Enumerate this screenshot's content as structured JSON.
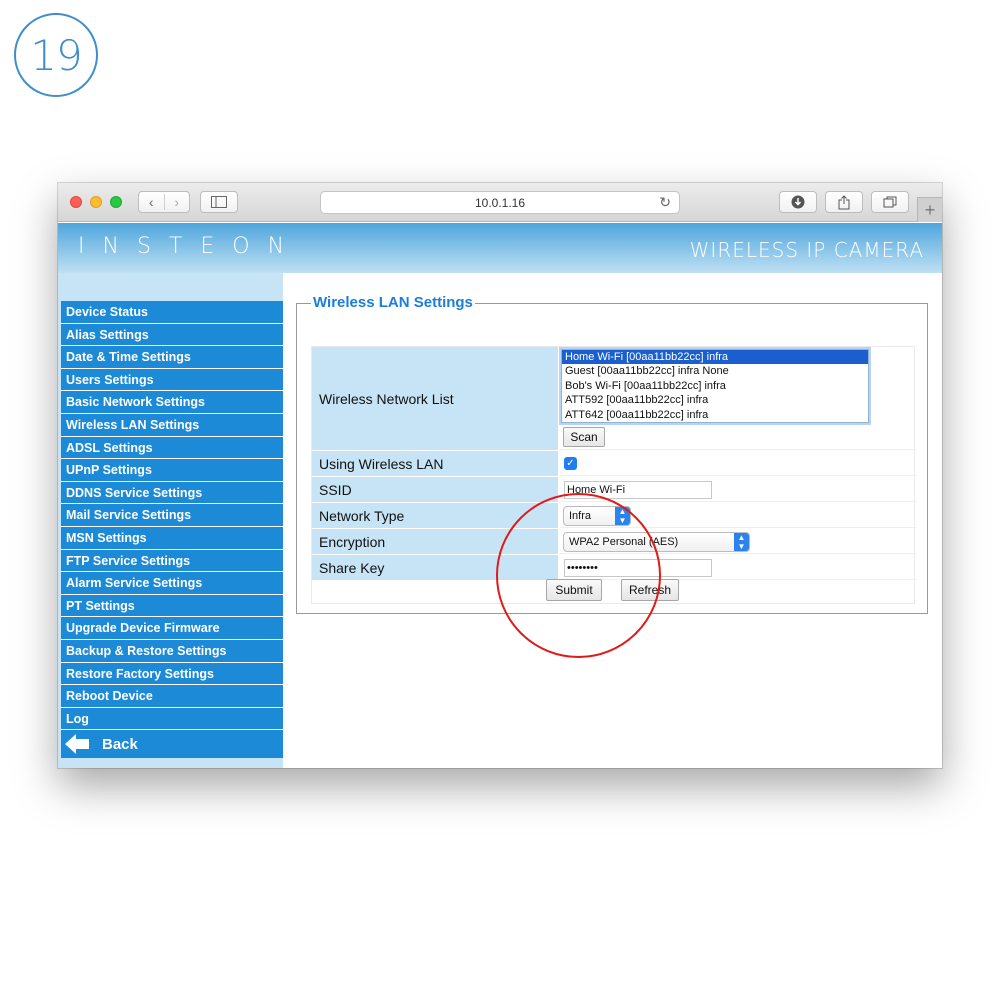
{
  "step_number": "19",
  "browser": {
    "url": "10.0.1.16"
  },
  "brand": {
    "logo": "INSTEON",
    "title": "WIRELESS IP CAMERA"
  },
  "menu": {
    "items": [
      "Device Status",
      "Alias Settings",
      "Date & Time Settings",
      "Users Settings",
      "Basic Network Settings",
      "Wireless LAN Settings",
      "ADSL Settings",
      "UPnP Settings",
      "DDNS Service Settings",
      "Mail Service Settings",
      "MSN Settings",
      "FTP Service Settings",
      "Alarm Service Settings",
      "PT Settings",
      "Upgrade Device Firmware",
      "Backup & Restore Settings",
      "Restore Factory Settings",
      "Reboot Device",
      "Log"
    ],
    "back_label": "Back"
  },
  "form": {
    "legend": "Wireless LAN Settings",
    "network_list_label": "Wireless Network List",
    "networks": [
      "Home Wi-Fi [00aa11bb22cc] infra",
      "Guest [00aa11bb22cc] infra None",
      "Bob's Wi-Fi [00aa11bb22cc] infra",
      "ATT592 [00aa11bb22cc] infra",
      "ATT642 [00aa11bb22cc] infra"
    ],
    "selected_network_index": 0,
    "scan_label": "Scan",
    "using_wireless_label": "Using Wireless LAN",
    "using_wireless_checked": true,
    "ssid_label": "SSID",
    "ssid_value": "Home Wi-Fi",
    "network_type_label": "Network Type",
    "network_type_value": "Infra",
    "encryption_label": "Encryption",
    "encryption_value": "WPA2 Personal (AES)",
    "share_key_label": "Share Key",
    "share_key_value": "••••••••",
    "submit_label": "Submit",
    "refresh_label": "Refresh"
  },
  "colors": {
    "menu_blue": "#1c8ad6",
    "label_bg": "#c7e4f6",
    "legend_blue": "#1c7ed6",
    "annotation_red": "#e01919",
    "badge_blue": "#3f8ec9"
  }
}
